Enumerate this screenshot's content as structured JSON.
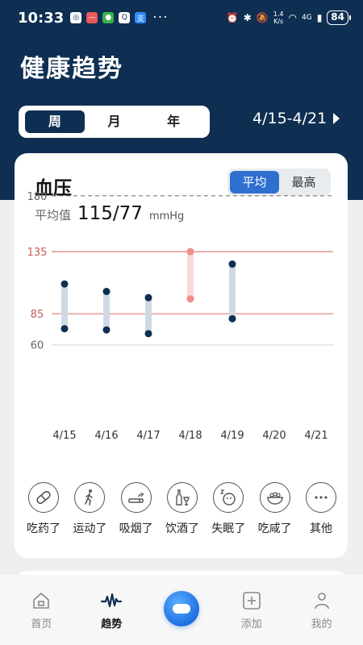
{
  "status_bar": {
    "time": "10:33",
    "dots": "···",
    "network_speed_value": "1.4",
    "network_speed_unit": "K/s",
    "network_type": "4G",
    "battery": "84"
  },
  "header": {
    "title": "健康趋势",
    "period_tabs": [
      {
        "label": "周",
        "active": true
      },
      {
        "label": "月",
        "active": false
      },
      {
        "label": "年",
        "active": false
      }
    ],
    "date_range": "4/15-4/21"
  },
  "card": {
    "title": "血压",
    "mode_tabs": [
      {
        "label": "平均",
        "active": true
      },
      {
        "label": "最高",
        "active": false
      }
    ],
    "average_label": "平均值",
    "average_value": "115/77",
    "average_unit": "mmHg"
  },
  "chart_data": {
    "type": "range-bar",
    "title": "",
    "categories": [
      "4/15",
      "4/16",
      "4/17",
      "4/18",
      "4/19",
      "4/20",
      "4/21"
    ],
    "y_ticks": [
      180,
      135,
      85,
      60
    ],
    "ylim": [
      60,
      180
    ],
    "reference_lines": [
      {
        "value": 180,
        "style": "dashed",
        "color": "#777777"
      },
      {
        "value": 135,
        "style": "solid",
        "color": "#e07a7a"
      },
      {
        "value": 85,
        "style": "solid",
        "color": "#e07a7a"
      },
      {
        "value": 60,
        "style": "solid",
        "color": "#dddddd"
      }
    ],
    "series": [
      {
        "low": 73,
        "high": 109,
        "highlight": false
      },
      {
        "low": 72,
        "high": 103,
        "highlight": false
      },
      {
        "low": 69,
        "high": 98,
        "highlight": false
      },
      {
        "low": 97,
        "high": 135,
        "highlight": true
      },
      {
        "low": 81,
        "high": 125,
        "highlight": false
      },
      null,
      null
    ],
    "colors": {
      "normal_bar": "#cfd9e3",
      "normal_dot": "#0f2f52",
      "high_bar": "#fadada",
      "high_dot": "#f08c8c",
      "tick_red": "#c75c5c",
      "tick_gray": "#666666"
    }
  },
  "events": [
    {
      "label": "吃药了",
      "icon": "pill-icon"
    },
    {
      "label": "运动了",
      "icon": "walking-icon"
    },
    {
      "label": "吸烟了",
      "icon": "cigarette-icon"
    },
    {
      "label": "饮酒了",
      "icon": "wine-icon"
    },
    {
      "label": "失眠了",
      "icon": "sleepless-icon"
    },
    {
      "label": "吃咸了",
      "icon": "salty-food-icon"
    },
    {
      "label": "其他",
      "icon": "more-icon"
    }
  ],
  "tabbar": [
    {
      "label": "首页",
      "icon": "home-icon",
      "active": false
    },
    {
      "label": "趋势",
      "icon": "trend-icon",
      "active": true
    },
    {
      "label": "",
      "icon": "assistant-icon",
      "active": false
    },
    {
      "label": "添加",
      "icon": "add-icon",
      "active": false
    },
    {
      "label": "我的",
      "icon": "profile-icon",
      "active": false
    }
  ]
}
